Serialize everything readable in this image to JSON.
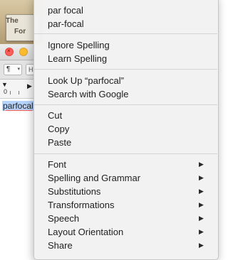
{
  "background_window": {
    "thumbnail_lines": [
      "The",
      "For"
    ],
    "toolbar": {
      "paragraph_button": "¶",
      "next_button": "H"
    },
    "ruler": {
      "zero_label": "0"
    },
    "document": {
      "selected_word": "parfocal"
    }
  },
  "context_menu": {
    "sections": [
      {
        "name": "spelling-suggestions",
        "items": [
          {
            "label": "par focal"
          },
          {
            "label": "par-focal"
          }
        ]
      },
      {
        "name": "spelling-actions",
        "items": [
          {
            "label": "Ignore Spelling"
          },
          {
            "label": "Learn Spelling"
          }
        ]
      },
      {
        "name": "lookup",
        "items": [
          {
            "label": "Look Up “parfocal”"
          },
          {
            "label": "Search with Google"
          }
        ]
      },
      {
        "name": "clipboard",
        "items": [
          {
            "label": "Cut"
          },
          {
            "label": "Copy"
          },
          {
            "label": "Paste"
          }
        ]
      },
      {
        "name": "submenus",
        "items": [
          {
            "label": "Font",
            "submenu": true
          },
          {
            "label": "Spelling and Grammar",
            "submenu": true
          },
          {
            "label": "Substitutions",
            "submenu": true
          },
          {
            "label": "Transformations",
            "submenu": true
          },
          {
            "label": "Speech",
            "submenu": true
          },
          {
            "label": "Layout Orientation",
            "submenu": true
          },
          {
            "label": "Share",
            "submenu": true
          }
        ]
      }
    ],
    "submenu_arrow_icon": "triangle-right-icon"
  },
  "colors": {
    "selection_highlight": "#b6d3fb",
    "spelling_underline": "#e0322a",
    "close_button": "#fc5f57",
    "minimize_button": "#fdbc2e"
  }
}
